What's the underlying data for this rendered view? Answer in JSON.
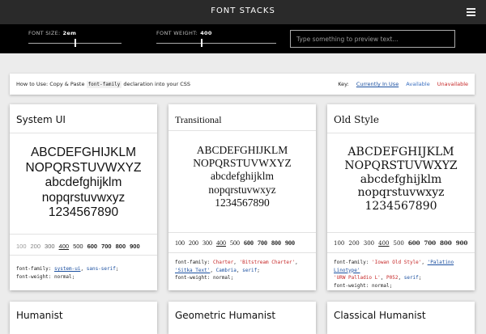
{
  "header": {
    "title": "FONT STACKS",
    "menu_icon": "hamburger-menu-icon"
  },
  "controls": {
    "font_size_label": "FONT SIZE:",
    "font_size_value": "2em",
    "font_size_fraction": 0.5,
    "font_weight_label": "FONT WEIGHT:",
    "font_weight_value": "400",
    "font_weight_fraction": 0.4,
    "preview_placeholder": "Type something to preview text..."
  },
  "howto": {
    "prefix": "How to Use:  Copy & Paste",
    "code": "font-family",
    "suffix": "declaration into your CSS",
    "key_label": "Key:",
    "key_in_use": "Currently In Use",
    "key_available": "Available",
    "key_unavailable": "Unavailable",
    "colors": {
      "in_use": "#1a4fa0",
      "available": "#3a6fc0",
      "unavailable": "#c62828"
    }
  },
  "specimen": {
    "line1": "ABCDEFGHIJKLM",
    "line2": "NOPQRSTUVWXYZ",
    "line3": "abcdefghijklm",
    "line4": "nopqrstuvwxyz",
    "line5": "1234567890"
  },
  "weights": [
    "100",
    "200",
    "300",
    "400",
    "500",
    "600",
    "700",
    "800",
    "900"
  ],
  "cards": [
    {
      "title": "System UI",
      "css_line1_prop": "font-family:",
      "css_line1_vals": [
        "system-ui",
        "sans-serif"
      ],
      "css_line2_prop": "font-weight:",
      "css_line2_val": "normal;"
    },
    {
      "title": "Transitional",
      "css_line1_prop": "font-family:",
      "css_line1_vals": [
        "Charter",
        "'Bitstream Charter'",
        "'Sitka Text'",
        "Cambria",
        "serif"
      ],
      "css_line2_prop": "font-weight:",
      "css_line2_val": "normal;"
    },
    {
      "title": "Old Style",
      "css_line1_prop": "font-family:",
      "css_line1_vals": [
        "'Iowan Old Style'",
        "'Palatino Linotype'",
        "'URW Palladio L'",
        "P052",
        "serif"
      ],
      "css_line2_prop": "font-weight:",
      "css_line2_val": "normal;"
    },
    {
      "title": "Humanist"
    },
    {
      "title": "Geometric Humanist"
    },
    {
      "title": "Classical Humanist"
    }
  ]
}
